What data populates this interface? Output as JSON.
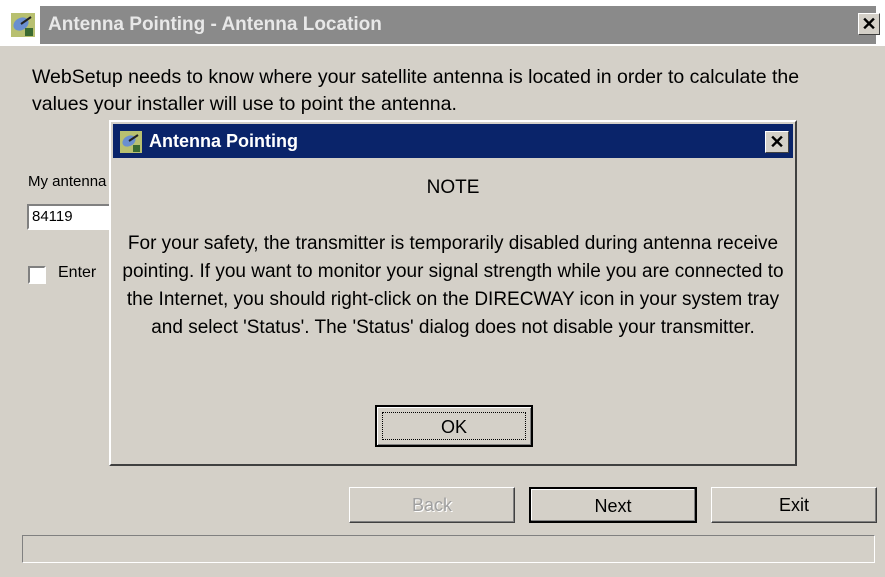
{
  "window": {
    "title": "Antenna Pointing - Antenna Location",
    "close_glyph": "✕"
  },
  "intro_text": "WebSetup needs to know where your satellite antenna is located in order to calculate the values your installer will use to point the antenna.",
  "location": {
    "label": "My antenna",
    "zip_value": "84119"
  },
  "enter_option": {
    "label": "Enter",
    "checked": false
  },
  "buttons": {
    "back": "Back",
    "next": "Next",
    "exit": "Exit"
  },
  "dialog": {
    "title": "Antenna Pointing",
    "close_glyph": "✕",
    "heading": "NOTE",
    "body": "For your safety, the transmitter is temporarily disabled during antenna receive pointing. If you want to monitor your signal strength while you are connected to the Internet, you should right-click on the DIRECWAY icon in your system tray and select 'Status'. The 'Status' dialog does not disable your transmitter.",
    "ok_label": "OK"
  },
  "icons": {
    "app": "satellite-dish-icon",
    "dialog": "satellite-dish-icon"
  }
}
